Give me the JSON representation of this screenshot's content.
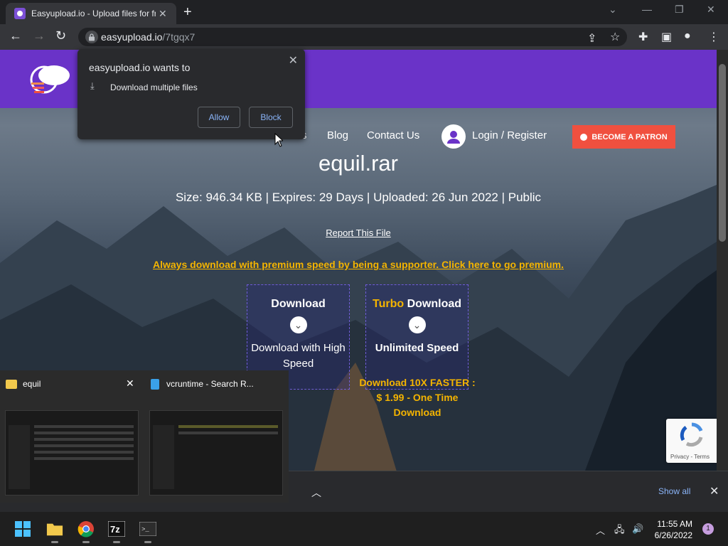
{
  "browser": {
    "tab_title": "Easyupload.io - Upload files for free",
    "url_host": "easyupload.io",
    "url_path": "/7tgqx7"
  },
  "permission_popup": {
    "title": "easyupload.io wants to",
    "permission": "Download multiple files",
    "allow_label": "Allow",
    "block_label": "Block"
  },
  "site": {
    "nav": {
      "partial_item": "s",
      "blog": "Blog",
      "contact": "Contact Us",
      "login": "Login / Register",
      "patron": "BECOME A PATRON"
    },
    "file": {
      "name": "equil.rar",
      "info": "Size: 946.34 KB | Expires: 29 Days | Uploaded: 26 Jun 2022 | Public",
      "report": "Report This File",
      "premium_link": "Always download with premium speed by being a supporter. Click here to go premium."
    },
    "download": {
      "title": "Download",
      "subtitle": "Download with High Speed"
    },
    "turbo": {
      "title_accent": "Turbo",
      "title_rest": " Download",
      "subtitle": "Unlimited Speed",
      "note": "Download 10X FASTER : $ 1.99 - One Time Download"
    },
    "recaptcha_terms": "Privacy - Terms"
  },
  "download_bar": {
    "show_all": "Show all"
  },
  "taskbar_preview": {
    "item1_title": "equil",
    "item2_title": "vcruntime - Search R..."
  },
  "taskbar": {
    "time": "11:55 AM",
    "date": "6/26/2022",
    "notification_count": "1"
  },
  "colors": {
    "brand_purple": "#6a33c8",
    "patron_red": "#f0503f",
    "premium_gold": "#f4b400",
    "link_blue": "#8ab4f8"
  }
}
